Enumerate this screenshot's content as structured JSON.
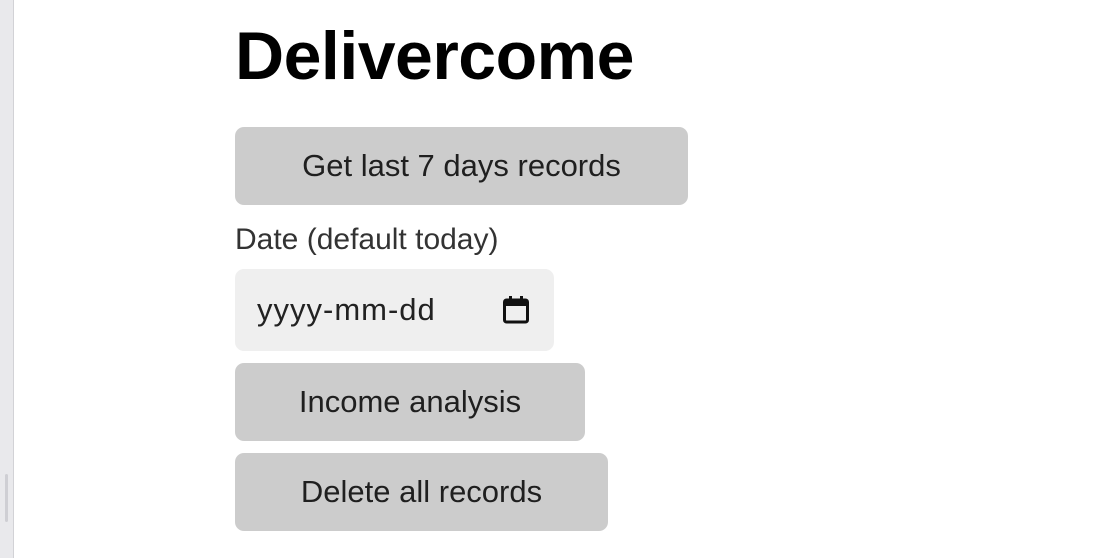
{
  "app": {
    "title": "Delivercome"
  },
  "actions": {
    "last7_label": "Get last 7 days records",
    "income_label": "Income analysis",
    "delete_label": "Delete all records"
  },
  "date": {
    "label": "Date (default today)",
    "placeholder": "yyyy-mm-dd",
    "value": "",
    "icon": "calendar-icon"
  }
}
